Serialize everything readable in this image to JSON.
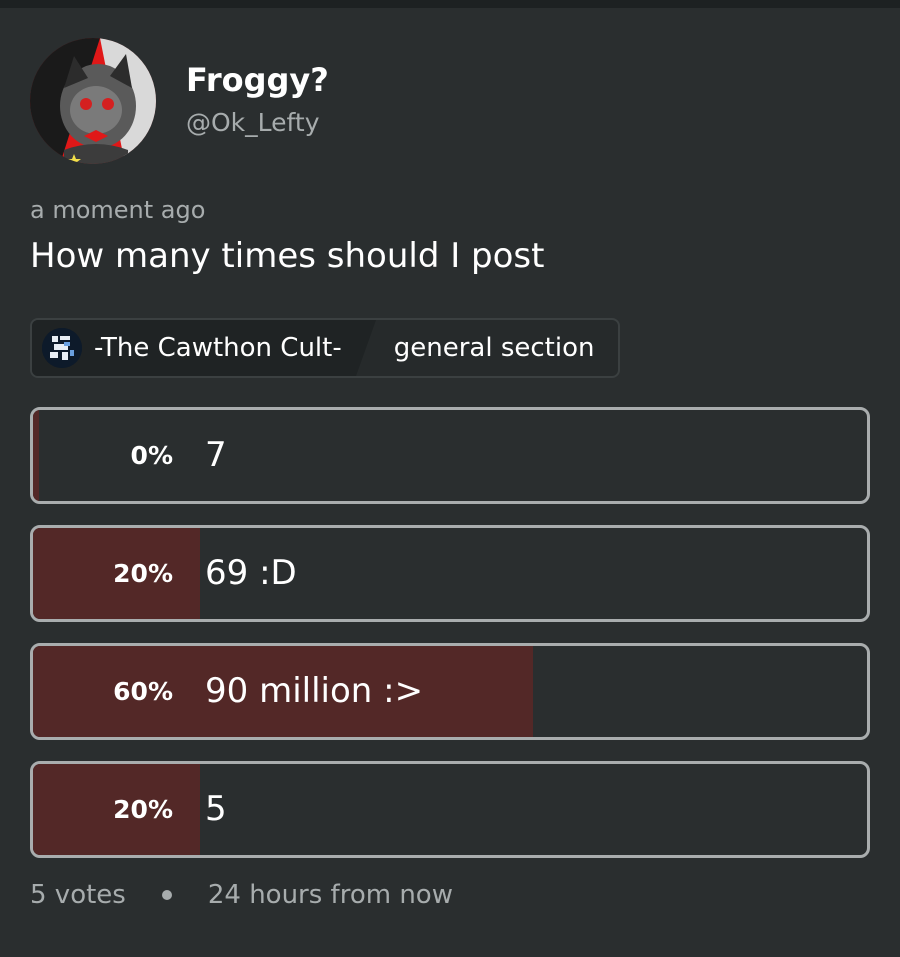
{
  "author": {
    "display_name": "Froggy?",
    "handle": "@Ok_Lefty"
  },
  "post": {
    "timestamp": "a moment ago",
    "question": "How many times should I post"
  },
  "community": {
    "name": "-The Cawthon Cult-",
    "section": "general section"
  },
  "poll": {
    "options": [
      {
        "percent_label": "0%",
        "label": "7",
        "fraction": 0.0
      },
      {
        "percent_label": "20%",
        "label": "69 :D",
        "fraction": 0.2
      },
      {
        "percent_label": "60%",
        "label": "90 million :>",
        "fraction": 0.6
      },
      {
        "percent_label": "20%",
        "label": "5",
        "fraction": 0.2
      }
    ],
    "votes_label": "5 votes",
    "time_left": "24 hours from now"
  },
  "colors": {
    "background": "#2a2e2f",
    "bar_fill": "#532827",
    "border": "#a9adae",
    "muted_text": "#a7acad"
  }
}
